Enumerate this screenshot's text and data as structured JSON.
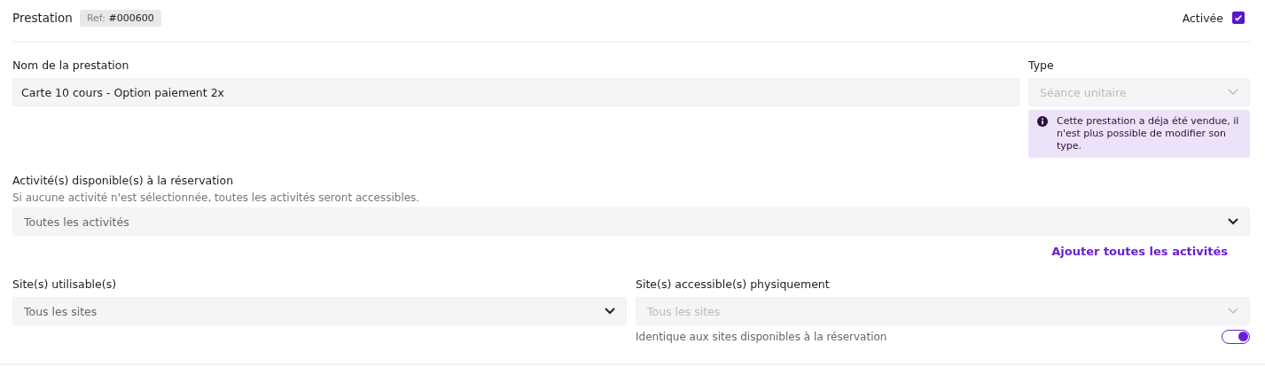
{
  "header": {
    "title": "Prestation",
    "ref_label": "Ref:",
    "ref_value": "#000600",
    "active_label": "Activée",
    "active_checked": true
  },
  "name_field": {
    "label": "Nom de la prestation",
    "value": "Carte 10 cours - Option paiement 2x"
  },
  "type_field": {
    "label": "Type",
    "value": "Séance unitaire",
    "disabled": true,
    "notice": "Cette prestation a déja été vendue, il n'est plus possible de modifier son type."
  },
  "activities_field": {
    "label": "Activité(s) disponible(s) à la réservation",
    "hint": "Si aucune activité n'est sélectionnée, toutes les activités seront accessibles.",
    "placeholder": "Toutes les activités",
    "disabled": false,
    "add_all_link": "Ajouter toutes les activités"
  },
  "sites_fields": [
    {
      "label": "Site(s) utilisable(s)",
      "placeholder": "Tous les sites",
      "disabled": false
    },
    {
      "label": "Site(s) accessible(s) physiquement",
      "placeholder": "Tous les sites",
      "disabled": true,
      "toggle_label": "Identique aux sites disponibles à la réservation",
      "toggle_on": true
    }
  ]
}
